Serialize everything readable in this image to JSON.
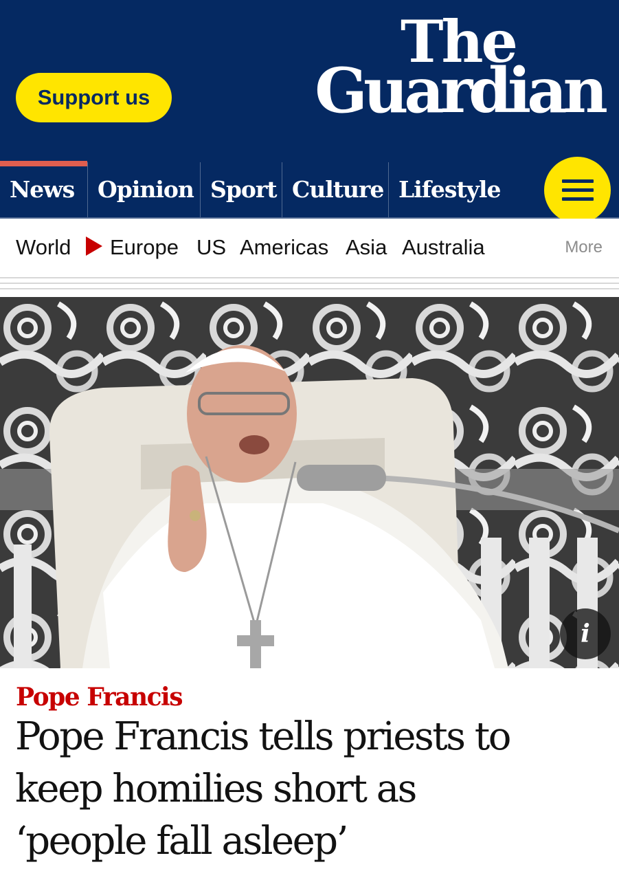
{
  "masthead": {
    "support_label": "Support us",
    "logo_line1": "The",
    "logo_line2": "Guardian",
    "background_color": "#052962",
    "accent_color": "#ffe500"
  },
  "pillars": [
    {
      "label": "News",
      "active": true
    },
    {
      "label": "Opinion",
      "active": false
    },
    {
      "label": "Sport",
      "active": false
    },
    {
      "label": "Culture",
      "active": false
    },
    {
      "label": "Lifestyle",
      "active": false
    }
  ],
  "menu_icon": "hamburger-icon",
  "subnav": {
    "section": "World",
    "items": [
      "Europe",
      "US",
      "Americas",
      "Asia",
      "Australia"
    ],
    "more_label": "More",
    "arrow_color": "#c70000"
  },
  "hero": {
    "info_label": "i",
    "info_icon": "info-icon"
  },
  "article": {
    "kicker": "Pope Francis",
    "kicker_color": "#c70000",
    "headline_lines": [
      "Pope Francis tells priests to",
      "keep homilies short as",
      "‘people fall asleep’"
    ]
  }
}
